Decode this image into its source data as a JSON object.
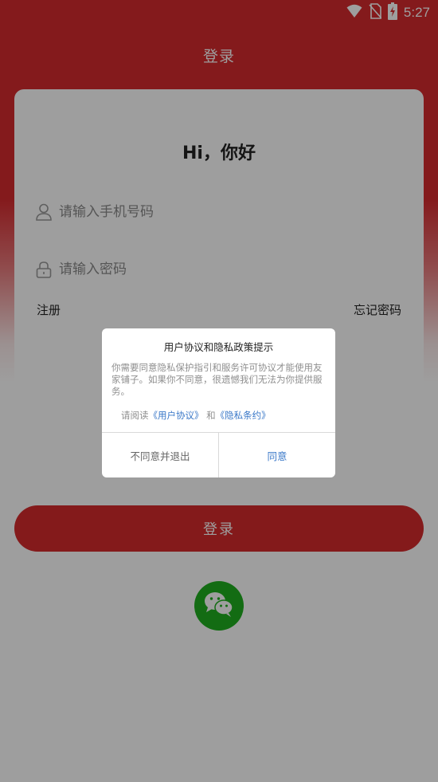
{
  "status_bar": {
    "time": "5:27",
    "icons": [
      "wifi-icon",
      "no-sim-icon",
      "battery-charging-icon"
    ]
  },
  "nav": {
    "title": "登录"
  },
  "login_form": {
    "greeting": "Hi，你好",
    "phone_placeholder": "请输入手机号码",
    "phone_icon": "user-icon",
    "password_placeholder": "请输入密码",
    "password_icon": "lock-icon",
    "register_label": "注册",
    "forgot_label": "忘记密码"
  },
  "login_button": {
    "label": "登录"
  },
  "wechat_login": {
    "icon": "wechat-icon"
  },
  "colors": {
    "brand_red": "#d62a2e",
    "wechat_green": "#1fae1f",
    "link_blue": "#3a78c8"
  },
  "privacy_dialog": {
    "title": "用户协议和隐私政策提示",
    "body": "你需要同意隐私保护指引和服务许可协议才能使用友家铺子。如果你不同意，很遗憾我们无法为你提供服务。",
    "read_prefix": "请阅读",
    "user_agreement_link": "《用户协议》",
    "and_text": "和",
    "privacy_link": "《隐私条约》",
    "decline_label": "不同意并退出",
    "agree_label": "同意"
  }
}
